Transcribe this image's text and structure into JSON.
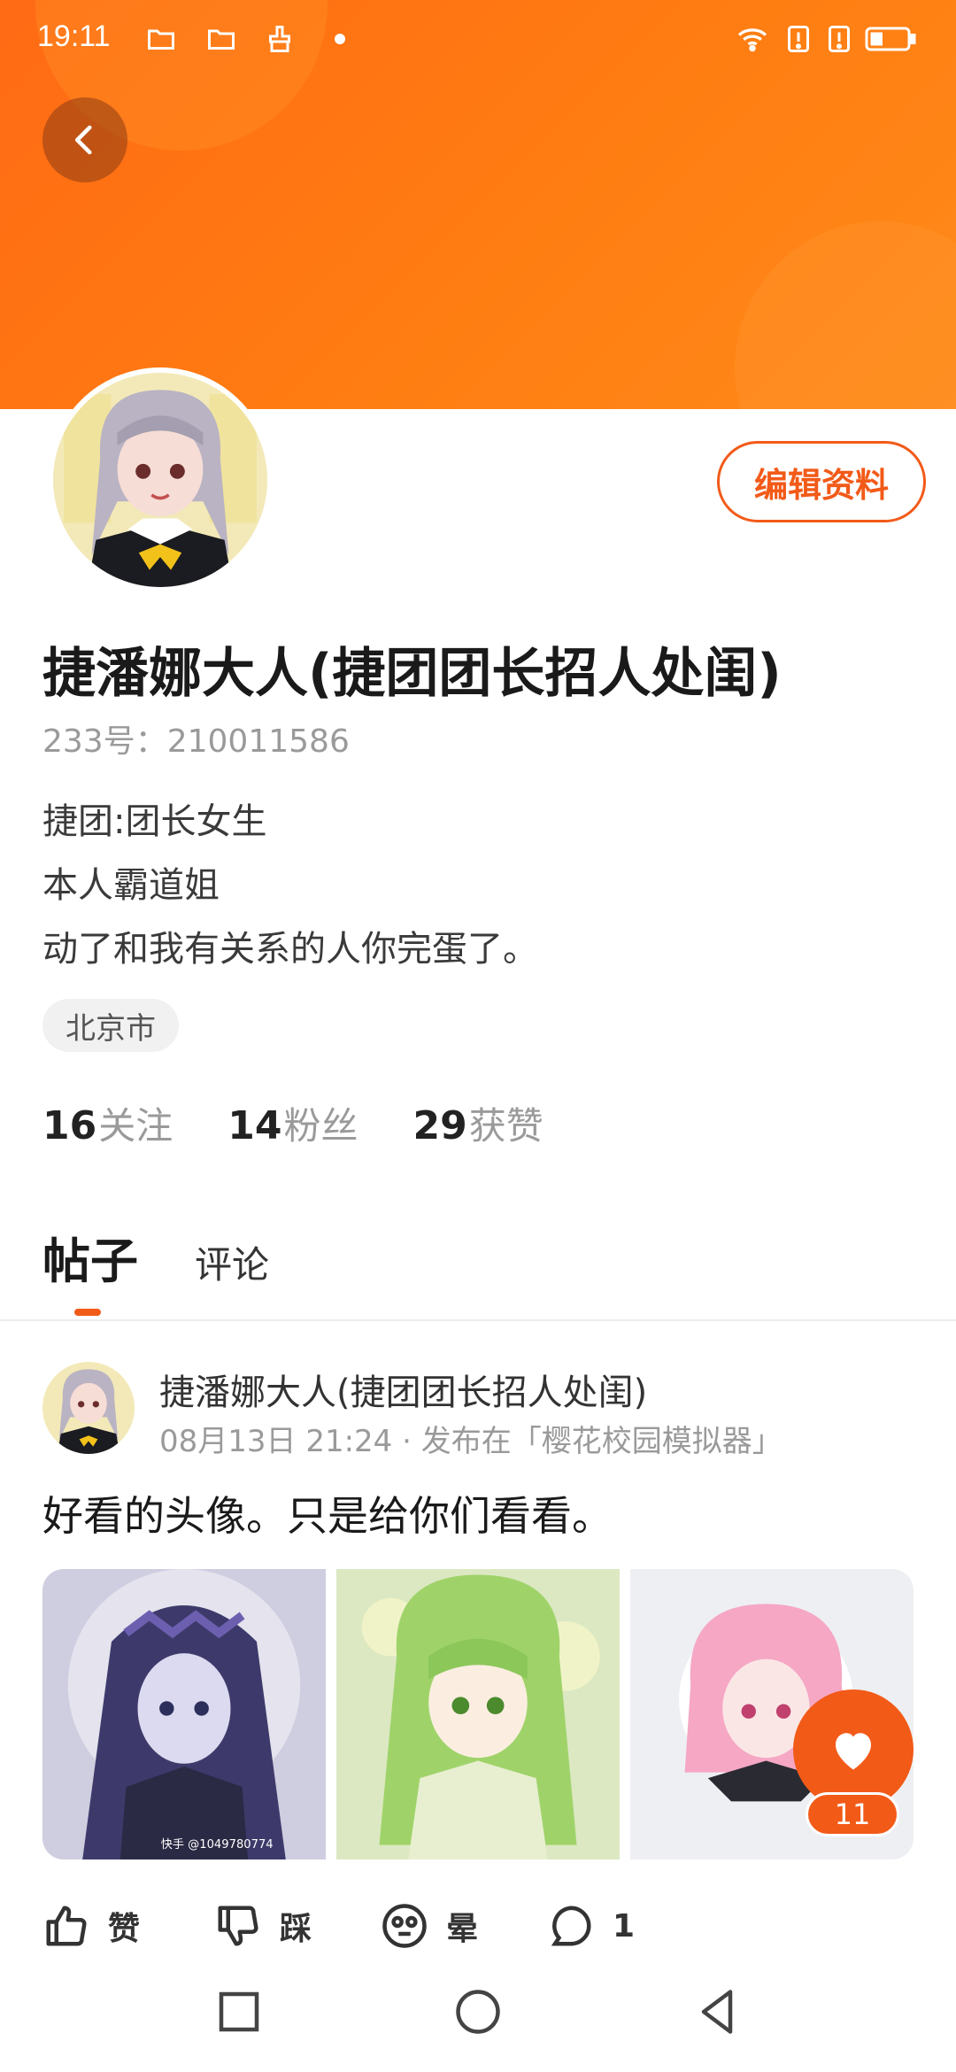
{
  "status_bar": {
    "time": "19:11",
    "left_icons": [
      "folder-icon",
      "folder-icon",
      "cleaner-icon",
      "dot"
    ],
    "right_icons": [
      "wifi-icon",
      "alert-icon",
      "alert-icon",
      "battery-icon"
    ]
  },
  "header": {
    "back_icon": "chevron-left-icon",
    "bg_color": "#ff6a14"
  },
  "profile": {
    "name": "捷潘娜大人(捷团团长招人处闺)",
    "uid": "233号：210011586",
    "edit_label": "编辑资料",
    "bio": [
      "捷团:团长女生",
      "本人霸道姐",
      "动了和我有关系的人你完蛋了。"
    ],
    "location": "北京市",
    "stats": [
      {
        "num": "16",
        "label": "关注"
      },
      {
        "num": "14",
        "label": "粉丝"
      },
      {
        "num": "29",
        "label": "获赞"
      }
    ]
  },
  "tabs": {
    "active": "帖子",
    "other": "评论"
  },
  "post": {
    "author": "捷潘娜大人(捷团团长招人处闺)",
    "meta": "08月13日 21:24 · 发布在「樱花校园模拟器」",
    "text": "好看的头像。只是给你们看看。",
    "image_watermark": "快手 @1049780774",
    "favorite_count": "11",
    "actions": [
      {
        "icon": "thumbs-up-icon",
        "label": "赞"
      },
      {
        "icon": "thumbs-down-icon",
        "label": "踩"
      },
      {
        "icon": "dizzy-face-icon",
        "label": "晕"
      },
      {
        "icon": "comment-icon",
        "label": "1"
      }
    ]
  },
  "nav_bar": {
    "keys": [
      "recent-apps-icon",
      "home-icon",
      "back-icon"
    ]
  },
  "colors": {
    "accent": "#f25a18",
    "header_orange": "#ff7d12"
  }
}
